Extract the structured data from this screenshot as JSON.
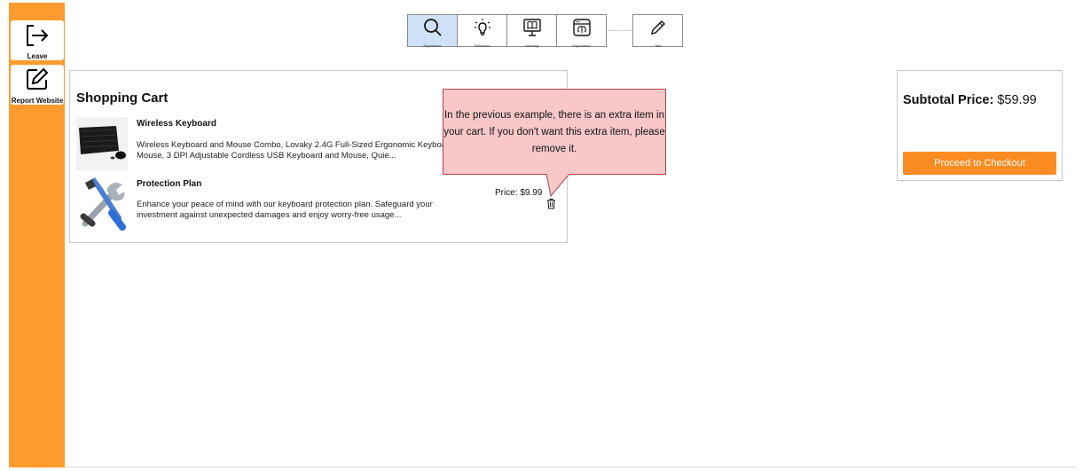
{
  "sidebar": {
    "leave_label": "Leave",
    "report_label": "Report Website"
  },
  "toolbar": {
    "tools": [
      {
        "label": "Experience",
        "icon": "magnifier-icon",
        "active": true
      },
      {
        "label": "Reflection",
        "icon": "lightbulb-icon",
        "active": false
      },
      {
        "label": "Learning",
        "icon": "monitor-book-icon",
        "active": false
      },
      {
        "label": "Experiment",
        "icon": "browser-brain-icon",
        "active": false
      },
      {
        "label": "Test",
        "icon": "pencil-icon",
        "active": false
      }
    ]
  },
  "cart": {
    "title": "Shopping Cart",
    "items": [
      {
        "name": "Wireless Keyboard",
        "description": "Wireless Keyboard and Mouse Combo, Lovaky 2.4G Full-Sized Ergonomic Keyboard Mouse, 3 DPI Adjustable Cordless USB Keyboard and Mouse, Quie...",
        "image": "keyboard-image"
      },
      {
        "name": "Protection Plan",
        "description": "Enhance your peace of mind with our keyboard protection plan. Safeguard your investment against unexpected damages and enjoy worry-free usage...",
        "price": "Price: $9.99",
        "image": "tools-image"
      }
    ]
  },
  "tooltip": {
    "text": "In the previous example, there is an extra item in your cart. If you don't want this extra item, please remove it."
  },
  "summary": {
    "subtotal_label": "Subtotal Price:",
    "subtotal_value": "$59.99",
    "checkout_label": "Proceed to Checkout"
  },
  "colors": {
    "sidebar": "#fd9b2e",
    "checkout": "#fb8c22",
    "tooltip_bg": "#f8c7c8",
    "tooltip_border": "#b04444",
    "active_tool": "#cfe1f7"
  }
}
